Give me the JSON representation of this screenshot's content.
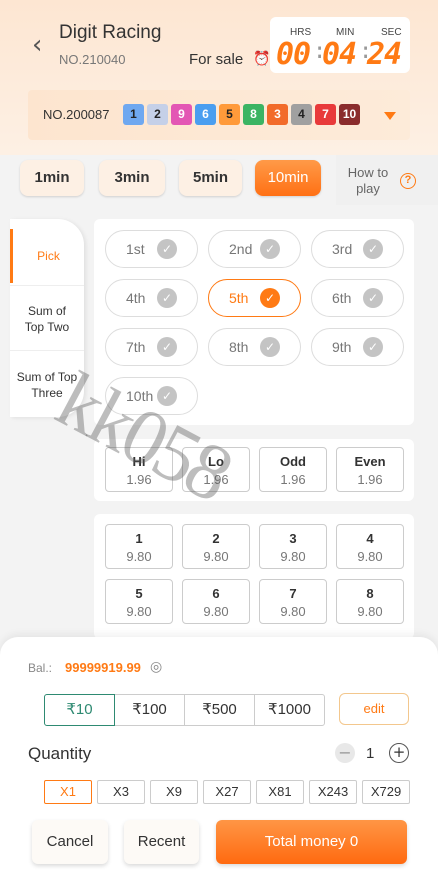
{
  "header": {
    "title": "Digit Racing",
    "issue_no": "NO.210040",
    "for_sale": "For sale",
    "timer": {
      "hrs_label": "HRS",
      "min_label": "MIN",
      "sec_label": "SEC",
      "hrs": "00",
      "min": "04",
      "sec": "24"
    }
  },
  "result": {
    "issue_no": "NO.200087",
    "balls": [
      {
        "n": "1",
        "color": "#6fa8f0"
      },
      {
        "n": "2",
        "color": "#c5d0e8"
      },
      {
        "n": "9",
        "color": "#e356b4"
      },
      {
        "n": "6",
        "color": "#4a9ef0"
      },
      {
        "n": "5",
        "color": "#ff9a3a"
      },
      {
        "n": "8",
        "color": "#3bb463"
      },
      {
        "n": "3",
        "color": "#f26b2a"
      },
      {
        "n": "4",
        "color": "#a0a0a0"
      },
      {
        "n": "7",
        "color": "#e83a3a"
      },
      {
        "n": "10",
        "color": "#8a2c2c"
      }
    ]
  },
  "time_tabs": [
    {
      "label": "1min"
    },
    {
      "label": "3min"
    },
    {
      "label": "5min"
    },
    {
      "label": "10min",
      "active": true
    }
  ],
  "how_to_play": "How to play",
  "side_nav": [
    {
      "label": "Pick",
      "active": true
    },
    {
      "label": "Sum of Top Two"
    },
    {
      "label": "Sum of Top Three"
    }
  ],
  "positions": [
    "1st",
    "2nd",
    "3rd",
    "4th",
    "5th",
    "6th",
    "7th",
    "8th",
    "9th",
    "10th"
  ],
  "active_position": "5th",
  "bet_options": [
    {
      "name": "Hi",
      "odds": "1.96"
    },
    {
      "name": "Lo",
      "odds": "1.96"
    },
    {
      "name": "Odd",
      "odds": "1.96"
    },
    {
      "name": "Even",
      "odds": "1.96"
    }
  ],
  "numbers": [
    {
      "name": "1",
      "odds": "9.80"
    },
    {
      "name": "2",
      "odds": "9.80"
    },
    {
      "name": "3",
      "odds": "9.80"
    },
    {
      "name": "4",
      "odds": "9.80"
    },
    {
      "name": "5",
      "odds": "9.80"
    },
    {
      "name": "6",
      "odds": "9.80"
    },
    {
      "name": "7",
      "odds": "9.80"
    },
    {
      "name": "8",
      "odds": "9.80"
    }
  ],
  "watermark": "kk058",
  "bet_panel": {
    "balance_label": "Bal.:",
    "balance": "99999919.99",
    "amounts": [
      "₹10",
      "₹100",
      "₹500",
      "₹1000"
    ],
    "edit_label": "edit",
    "quantity_label": "Quantity",
    "quantity": "1",
    "multipliers": [
      "X1",
      "X3",
      "X9",
      "X27",
      "X81",
      "X243",
      "X729"
    ],
    "cancel_label": "Cancel",
    "recent_label": "Recent",
    "total_label": "Total money 0"
  }
}
